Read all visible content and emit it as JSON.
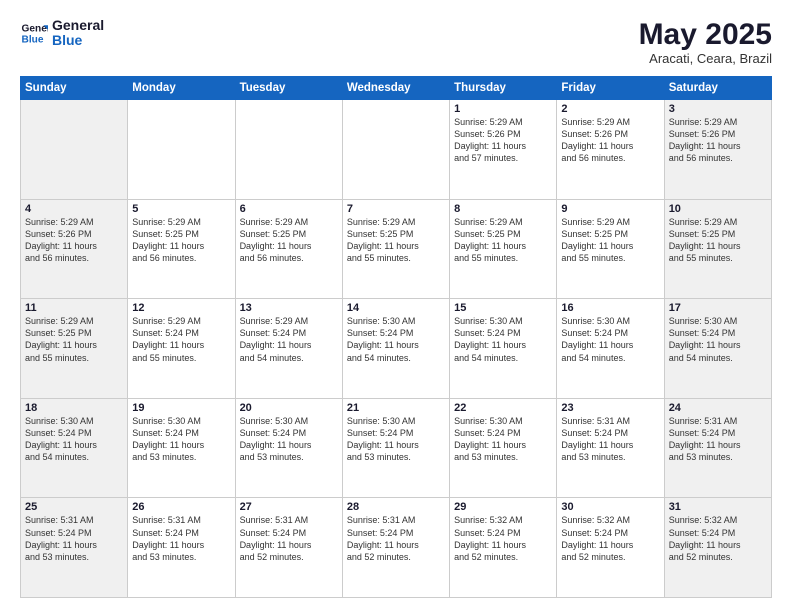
{
  "header": {
    "logo_line1": "General",
    "logo_line2": "Blue",
    "month": "May 2025",
    "location": "Aracati, Ceara, Brazil"
  },
  "weekdays": [
    "Sunday",
    "Monday",
    "Tuesday",
    "Wednesday",
    "Thursday",
    "Friday",
    "Saturday"
  ],
  "rows": [
    [
      {
        "day": "",
        "info": ""
      },
      {
        "day": "",
        "info": ""
      },
      {
        "day": "",
        "info": ""
      },
      {
        "day": "",
        "info": ""
      },
      {
        "day": "1",
        "info": "Sunrise: 5:29 AM\nSunset: 5:26 PM\nDaylight: 11 hours\nand 57 minutes."
      },
      {
        "day": "2",
        "info": "Sunrise: 5:29 AM\nSunset: 5:26 PM\nDaylight: 11 hours\nand 56 minutes."
      },
      {
        "day": "3",
        "info": "Sunrise: 5:29 AM\nSunset: 5:26 PM\nDaylight: 11 hours\nand 56 minutes."
      }
    ],
    [
      {
        "day": "4",
        "info": "Sunrise: 5:29 AM\nSunset: 5:26 PM\nDaylight: 11 hours\nand 56 minutes."
      },
      {
        "day": "5",
        "info": "Sunrise: 5:29 AM\nSunset: 5:25 PM\nDaylight: 11 hours\nand 56 minutes."
      },
      {
        "day": "6",
        "info": "Sunrise: 5:29 AM\nSunset: 5:25 PM\nDaylight: 11 hours\nand 56 minutes."
      },
      {
        "day": "7",
        "info": "Sunrise: 5:29 AM\nSunset: 5:25 PM\nDaylight: 11 hours\nand 55 minutes."
      },
      {
        "day": "8",
        "info": "Sunrise: 5:29 AM\nSunset: 5:25 PM\nDaylight: 11 hours\nand 55 minutes."
      },
      {
        "day": "9",
        "info": "Sunrise: 5:29 AM\nSunset: 5:25 PM\nDaylight: 11 hours\nand 55 minutes."
      },
      {
        "day": "10",
        "info": "Sunrise: 5:29 AM\nSunset: 5:25 PM\nDaylight: 11 hours\nand 55 minutes."
      }
    ],
    [
      {
        "day": "11",
        "info": "Sunrise: 5:29 AM\nSunset: 5:25 PM\nDaylight: 11 hours\nand 55 minutes."
      },
      {
        "day": "12",
        "info": "Sunrise: 5:29 AM\nSunset: 5:24 PM\nDaylight: 11 hours\nand 55 minutes."
      },
      {
        "day": "13",
        "info": "Sunrise: 5:29 AM\nSunset: 5:24 PM\nDaylight: 11 hours\nand 54 minutes."
      },
      {
        "day": "14",
        "info": "Sunrise: 5:30 AM\nSunset: 5:24 PM\nDaylight: 11 hours\nand 54 minutes."
      },
      {
        "day": "15",
        "info": "Sunrise: 5:30 AM\nSunset: 5:24 PM\nDaylight: 11 hours\nand 54 minutes."
      },
      {
        "day": "16",
        "info": "Sunrise: 5:30 AM\nSunset: 5:24 PM\nDaylight: 11 hours\nand 54 minutes."
      },
      {
        "day": "17",
        "info": "Sunrise: 5:30 AM\nSunset: 5:24 PM\nDaylight: 11 hours\nand 54 minutes."
      }
    ],
    [
      {
        "day": "18",
        "info": "Sunrise: 5:30 AM\nSunset: 5:24 PM\nDaylight: 11 hours\nand 54 minutes."
      },
      {
        "day": "19",
        "info": "Sunrise: 5:30 AM\nSunset: 5:24 PM\nDaylight: 11 hours\nand 53 minutes."
      },
      {
        "day": "20",
        "info": "Sunrise: 5:30 AM\nSunset: 5:24 PM\nDaylight: 11 hours\nand 53 minutes."
      },
      {
        "day": "21",
        "info": "Sunrise: 5:30 AM\nSunset: 5:24 PM\nDaylight: 11 hours\nand 53 minutes."
      },
      {
        "day": "22",
        "info": "Sunrise: 5:30 AM\nSunset: 5:24 PM\nDaylight: 11 hours\nand 53 minutes."
      },
      {
        "day": "23",
        "info": "Sunrise: 5:31 AM\nSunset: 5:24 PM\nDaylight: 11 hours\nand 53 minutes."
      },
      {
        "day": "24",
        "info": "Sunrise: 5:31 AM\nSunset: 5:24 PM\nDaylight: 11 hours\nand 53 minutes."
      }
    ],
    [
      {
        "day": "25",
        "info": "Sunrise: 5:31 AM\nSunset: 5:24 PM\nDaylight: 11 hours\nand 53 minutes."
      },
      {
        "day": "26",
        "info": "Sunrise: 5:31 AM\nSunset: 5:24 PM\nDaylight: 11 hours\nand 53 minutes."
      },
      {
        "day": "27",
        "info": "Sunrise: 5:31 AM\nSunset: 5:24 PM\nDaylight: 11 hours\nand 52 minutes."
      },
      {
        "day": "28",
        "info": "Sunrise: 5:31 AM\nSunset: 5:24 PM\nDaylight: 11 hours\nand 52 minutes."
      },
      {
        "day": "29",
        "info": "Sunrise: 5:32 AM\nSunset: 5:24 PM\nDaylight: 11 hours\nand 52 minutes."
      },
      {
        "day": "30",
        "info": "Sunrise: 5:32 AM\nSunset: 5:24 PM\nDaylight: 11 hours\nand 52 minutes."
      },
      {
        "day": "31",
        "info": "Sunrise: 5:32 AM\nSunset: 5:24 PM\nDaylight: 11 hours\nand 52 minutes."
      }
    ]
  ]
}
